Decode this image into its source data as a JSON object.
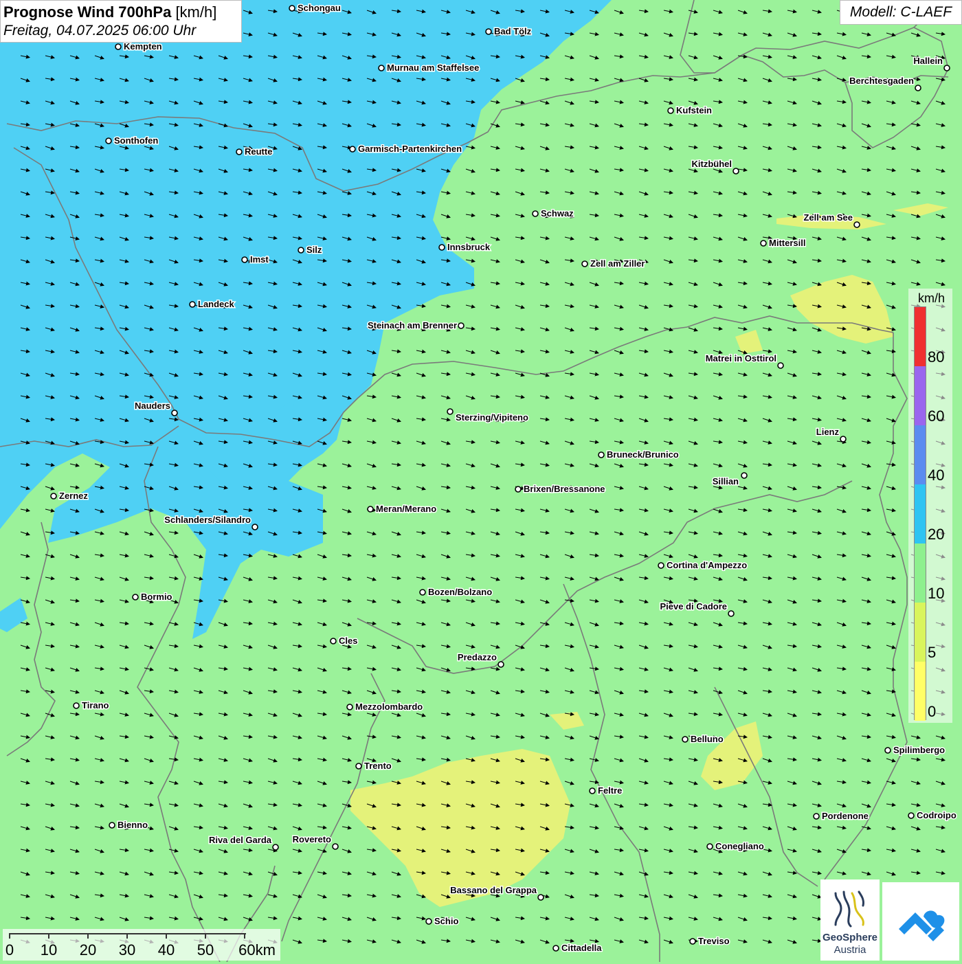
{
  "header": {
    "title_bold": "Prognose Wind 700hPa",
    "title_unit": "[km/h]",
    "datetime": "Freitag, 04.07.2025 06:00 Uhr"
  },
  "model_label": "Modell: C-LAEF",
  "legend": {
    "unit": "km/h",
    "ticks": [
      "0",
      "5",
      "10",
      "20",
      "40",
      "60",
      "80"
    ],
    "colors": [
      "#ffff66",
      "#d9f55c",
      "#8ef08e",
      "#2ec4f2",
      "#5b8cf0",
      "#9a66ee",
      "#f03030"
    ]
  },
  "scale_bar": {
    "labels": [
      "0",
      "10",
      "20",
      "30",
      "40",
      "50",
      "60km"
    ]
  },
  "map_colors": {
    "wind_10_20": "#9bf29a",
    "wind_20_40": "#4fd0f4",
    "wind_5_10": "#e4f27a",
    "borders": "#7a7a7a",
    "arrows": "#000000"
  },
  "cities": [
    {
      "name": "Schongau"
    },
    {
      "name": "Bad Tölz"
    },
    {
      "name": "Kempten"
    },
    {
      "name": "Murnau am Staffelsee"
    },
    {
      "name": "Hallein"
    },
    {
      "name": "Berchtesgaden"
    },
    {
      "name": "Kufstein"
    },
    {
      "name": "Sonthofen"
    },
    {
      "name": "Reutte"
    },
    {
      "name": "Garmisch-Partenkirchen"
    },
    {
      "name": "Kitzbühel"
    },
    {
      "name": "Schwaz"
    },
    {
      "name": "Zell am See"
    },
    {
      "name": "Mittersill"
    },
    {
      "name": "Silz"
    },
    {
      "name": "Innsbruck"
    },
    {
      "name": "Imst"
    },
    {
      "name": "Zell am Ziller"
    },
    {
      "name": "Landeck"
    },
    {
      "name": "Steinach am Brenner"
    },
    {
      "name": "Matrei in Osttirol"
    },
    {
      "name": "Nauders"
    },
    {
      "name": "Sterzing/Vipiteno"
    },
    {
      "name": "Lienz"
    },
    {
      "name": "Bruneck/Brunico"
    },
    {
      "name": "Sillian"
    },
    {
      "name": "Zernez"
    },
    {
      "name": "Brixen/Bressanone"
    },
    {
      "name": "Meran/Merano"
    },
    {
      "name": "Schlanders/Silandro"
    },
    {
      "name": "Cortina d'Ampezzo"
    },
    {
      "name": "Bozen/Bolzano"
    },
    {
      "name": "Bormio"
    },
    {
      "name": "Pieve di Cadore"
    },
    {
      "name": "Cles"
    },
    {
      "name": "Predazzo"
    },
    {
      "name": "Tirano"
    },
    {
      "name": "Mezzolombardo"
    },
    {
      "name": "Belluno"
    },
    {
      "name": "Spilimbergo"
    },
    {
      "name": "Trento"
    },
    {
      "name": "Feltre"
    },
    {
      "name": "Bienno"
    },
    {
      "name": "Pordenone"
    },
    {
      "name": "Codroipo"
    },
    {
      "name": "Riva del Garda"
    },
    {
      "name": "Rovereto"
    },
    {
      "name": "Conegliano"
    },
    {
      "name": "Bassano del Grappa"
    },
    {
      "name": "Schio"
    },
    {
      "name": "Treviso"
    },
    {
      "name": "Cittadella"
    }
  ],
  "logos": {
    "geosphere_line1": "GeoSphere",
    "geosphere_line2": "Austria"
  }
}
